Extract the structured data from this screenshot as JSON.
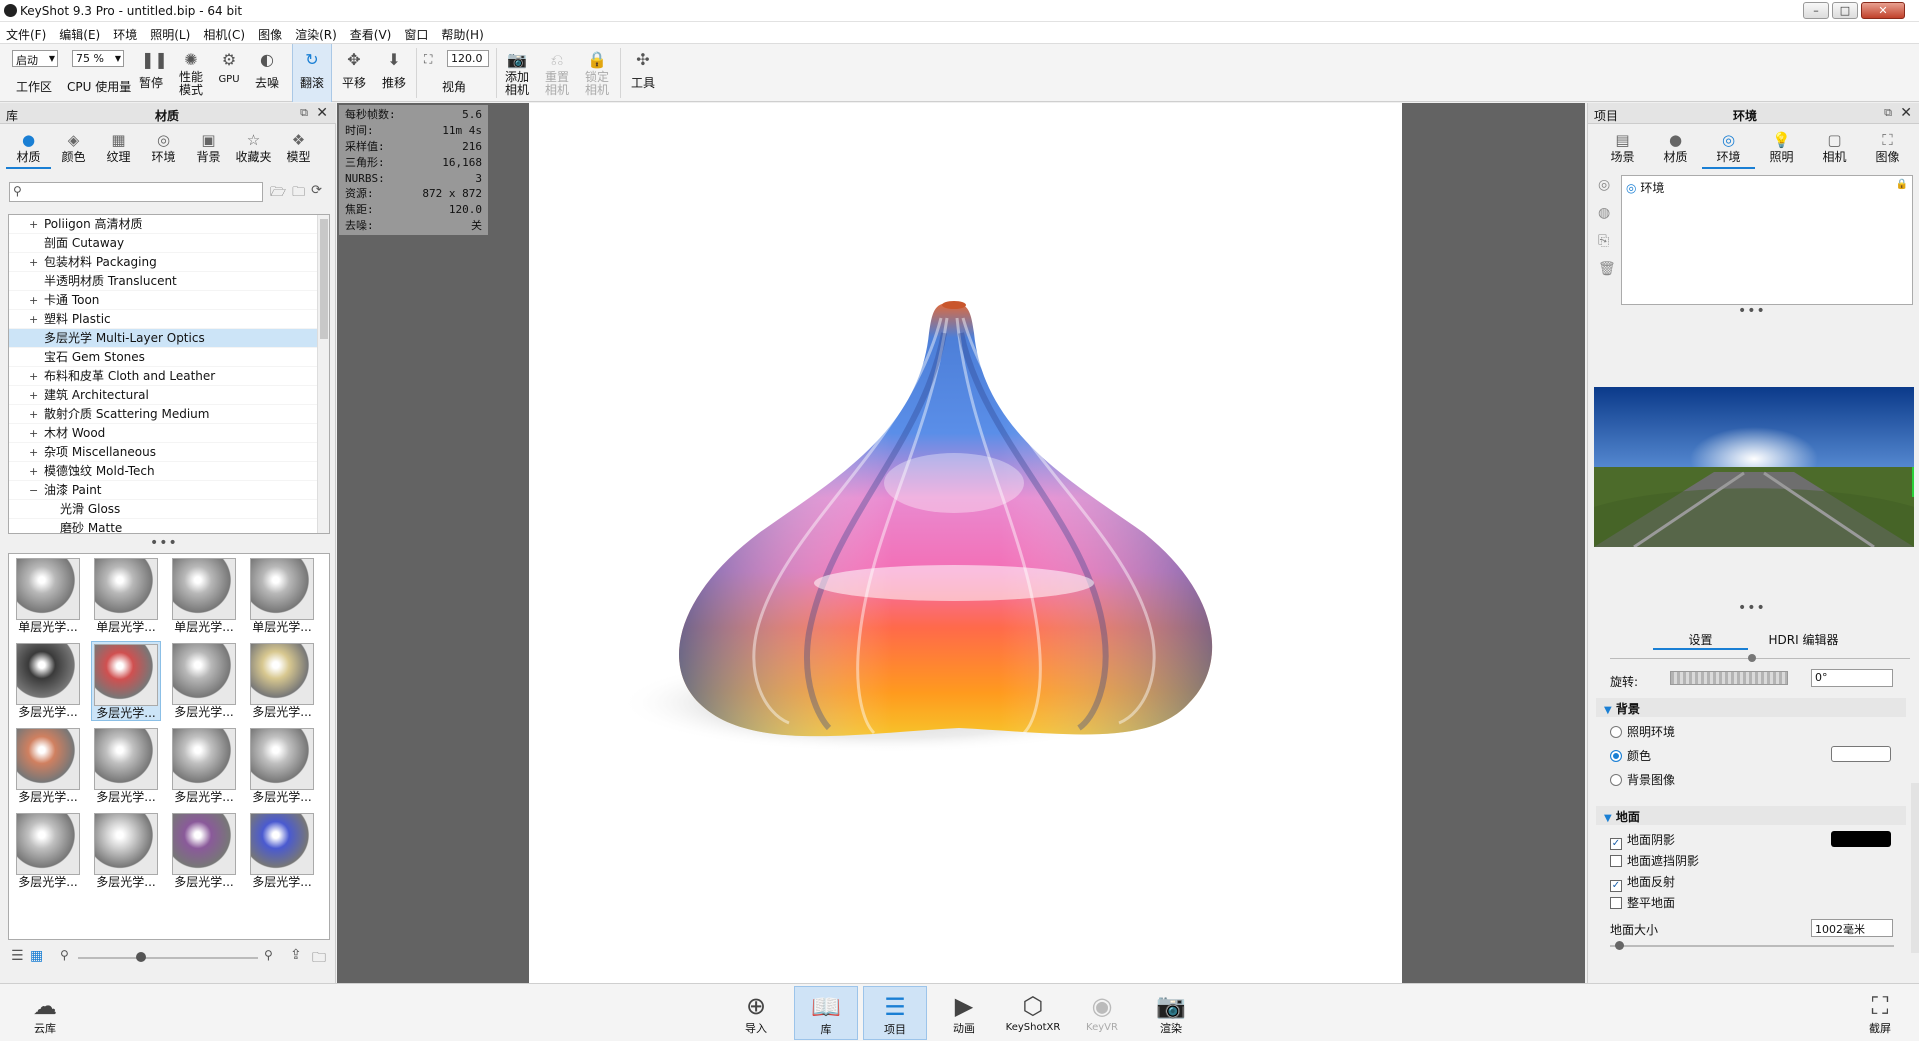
{
  "window": {
    "title": "KeyShot 9.3 Pro  - untitled.bip  - 64 bit"
  },
  "menu": [
    "文件(F)",
    "编辑(E)",
    "环境",
    "照明(L)",
    "相机(C)",
    "图像",
    "渲染(R)",
    "查看(V)",
    "窗口",
    "帮助(H)"
  ],
  "toolbar": {
    "workspace_value": "启动",
    "workspace_label": "工作区",
    "cpu_value": "75 %",
    "cpu_label": "CPU 使用量",
    "pause": "暂停",
    "perf1": "性能",
    "perf2": "模式",
    "gpu": "GPU",
    "denoise": "去噪",
    "tumble": "翻滚",
    "pan": "平移",
    "dolly": "推移",
    "fov_value": "120.0",
    "fov_label": "视角",
    "add_cam1": "添加",
    "add_cam2": "相机",
    "reset_cam1": "重置",
    "reset_cam2": "相机",
    "lock_cam1": "锁定",
    "lock_cam2": "相机",
    "tools": "工具"
  },
  "library": {
    "header_left": "库",
    "header_title": "材质",
    "tabs": [
      "材质",
      "颜色",
      "纹理",
      "环境",
      "背景",
      "收藏夹",
      "模型"
    ],
    "tree": [
      {
        "label": "Poliigon 高清材质",
        "exp": "+"
      },
      {
        "label": "剖面 Cutaway",
        "exp": ""
      },
      {
        "label": "包装材料 Packaging",
        "exp": "+"
      },
      {
        "label": "半透明材质 Translucent",
        "exp": ""
      },
      {
        "label": "卡通 Toon",
        "exp": "+"
      },
      {
        "label": "塑料 Plastic",
        "exp": "+"
      },
      {
        "label": "多层光学 Multi-Layer Optics",
        "exp": ""
      },
      {
        "label": "宝石 Gem Stones",
        "exp": ""
      },
      {
        "label": "布料和皮革 Cloth and Leather",
        "exp": "+"
      },
      {
        "label": "建筑 Architectural",
        "exp": "+"
      },
      {
        "label": "散射介质 Scattering Medium",
        "exp": "+"
      },
      {
        "label": "木材 Wood",
        "exp": "+"
      },
      {
        "label": "杂项 Miscellaneous",
        "exp": "+"
      },
      {
        "label": "模德蚀纹 Mold-Tech",
        "exp": "+"
      },
      {
        "label": "油漆 Paint",
        "exp": "−"
      },
      {
        "label": "光滑 Gloss",
        "exp": ""
      },
      {
        "label": "磨砂 Matte",
        "exp": ""
      }
    ],
    "thumbs": [
      "单层光学...",
      "单层光学...",
      "单层光学...",
      "单层光学...",
      "多层光学...",
      "多层光学...",
      "多层光学...",
      "多层光学...",
      "多层光学...",
      "多层光学...",
      "多层光学...",
      "多层光学...",
      "多层光学...",
      "多层光学...",
      "多层光学...",
      "多层光学..."
    ]
  },
  "hud": [
    {
      "k": "每秒帧数:",
      "v": "5.6"
    },
    {
      "k": "时间:",
      "v": "11m 4s"
    },
    {
      "k": "采样值:",
      "v": "216"
    },
    {
      "k": "三角形:",
      "v": "16,168"
    },
    {
      "k": "NURBS:",
      "v": "3"
    },
    {
      "k": "资源:",
      "v": "872 x 872"
    },
    {
      "k": "焦距:",
      "v": "120.0"
    },
    {
      "k": "去噪:",
      "v": "关"
    }
  ],
  "project": {
    "header_left": "项目",
    "header_title": "环境",
    "tabs": [
      "场景",
      "材质",
      "环境",
      "照明",
      "相机",
      "图像"
    ],
    "env_item": "环境",
    "set_tab": "设置",
    "hdri_tab": "HDRI 编辑器",
    "rotation_label": "旋转:",
    "rotation_value": "0°",
    "bg_section": "背景",
    "bg_options": [
      "照明环境",
      "颜色",
      "背景图像"
    ],
    "ground_section": "地面",
    "ground_opts": [
      {
        "label": "地面阴影",
        "checked": true
      },
      {
        "label": "地面遮挡阴影",
        "checked": false
      },
      {
        "label": "地面反射",
        "checked": true
      },
      {
        "label": "整平地面",
        "checked": false
      }
    ],
    "ground_size_label": "地面大小",
    "ground_size_value": "1002毫米"
  },
  "bottombar": {
    "cloud": "云库",
    "import": "导入",
    "library": "库",
    "project": "项目",
    "animation": "动画",
    "keyshotxr": "KeyShotXR",
    "keyvr": "KeyVR",
    "render": "渲染",
    "screenshot": "截屏"
  },
  "colors": {
    "accent": "#1a7fd4",
    "selection": "#cce4f7"
  }
}
